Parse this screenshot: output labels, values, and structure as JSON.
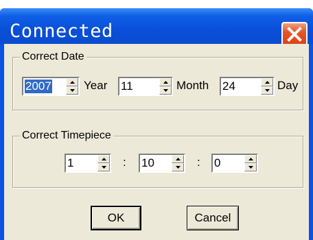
{
  "window": {
    "title": "Connected"
  },
  "date_group": {
    "label": "Correct Date",
    "year": {
      "value": "2007",
      "unit": "Year"
    },
    "month": {
      "value": "11",
      "unit": "Month"
    },
    "day": {
      "value": "24",
      "unit": "Day"
    }
  },
  "time_group": {
    "label": "Correct Timepiece",
    "hour": "1",
    "minute": "10",
    "second": "0",
    "separator": ":"
  },
  "buttons": {
    "ok": "OK",
    "cancel": "Cancel"
  },
  "icons": [
    "close-icon",
    "spin-up-icon",
    "spin-down-icon"
  ]
}
